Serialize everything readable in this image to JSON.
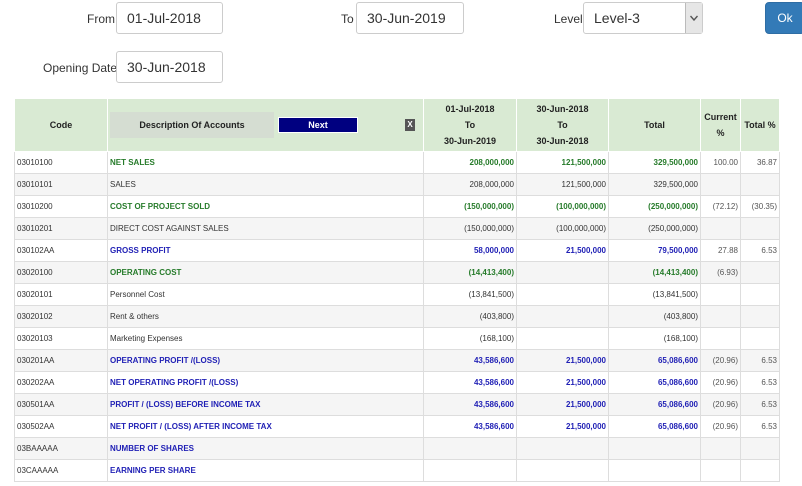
{
  "filters": {
    "from_label": "From",
    "from_value": "01-Jul-2018",
    "to_label": "To",
    "to_value": "30-Jun-2019",
    "level_label": "Level",
    "level_value": "Level-3",
    "ok_label": "Ok",
    "opening_date_label": "Opening Date",
    "opening_date_value": "30-Jun-2018"
  },
  "table": {
    "headers": {
      "code": "Code",
      "description": "Description Of Accounts",
      "next": "Next",
      "export_icon": "excel-export-icon",
      "period1_line1": "01-Jul-2018",
      "period1_line2": "To",
      "period1_line3": "30-Jun-2019",
      "period2_line1": "30-Jun-2018",
      "period2_line2": "To",
      "period2_line3": "30-Jun-2018",
      "total": "Total",
      "current_pct_line1": "Current",
      "current_pct_line2": "%",
      "total_pct": "Total %"
    },
    "rows": [
      {
        "code": "03010100",
        "desc": "NET SALES",
        "p1": "208,000,000",
        "p2": "121,500,000",
        "total": "329,500,000",
        "cur": "100.00",
        "tot": "36.87"
      },
      {
        "code": "03010101",
        "desc": "SALES",
        "p1": "208,000,000",
        "p2": "121,500,000",
        "total": "329,500,000",
        "cur": "",
        "tot": ""
      },
      {
        "code": "03010200",
        "desc": "COST OF PROJECT SOLD",
        "p1": "(150,000,000)",
        "p2": "(100,000,000)",
        "total": "(250,000,000)",
        "cur": "(72.12)",
        "tot": "(30.35)"
      },
      {
        "code": "03010201",
        "desc": "DIRECT COST AGAINST SALES",
        "p1": "(150,000,000)",
        "p2": "(100,000,000)",
        "total": "(250,000,000)",
        "cur": "",
        "tot": ""
      },
      {
        "code": "030102AA",
        "desc": "GROSS PROFIT",
        "p1": "58,000,000",
        "p2": "21,500,000",
        "total": "79,500,000",
        "cur": "27.88",
        "tot": "6.53"
      },
      {
        "code": "03020100",
        "desc": "OPERATING COST",
        "p1": "(14,413,400)",
        "p2": "",
        "total": "(14,413,400)",
        "cur": "(6.93)",
        "tot": ""
      },
      {
        "code": "03020101",
        "desc": "Personnel Cost",
        "p1": "(13,841,500)",
        "p2": "",
        "total": "(13,841,500)",
        "cur": "",
        "tot": ""
      },
      {
        "code": "03020102",
        "desc": "Rent & others",
        "p1": "(403,800)",
        "p2": "",
        "total": "(403,800)",
        "cur": "",
        "tot": ""
      },
      {
        "code": "03020103",
        "desc": "Marketing Expenses",
        "p1": "(168,100)",
        "p2": "",
        "total": "(168,100)",
        "cur": "",
        "tot": ""
      },
      {
        "code": "030201AA",
        "desc": "OPERATING PROFIT /(LOSS)",
        "p1": "43,586,600",
        "p2": "21,500,000",
        "total": "65,086,600",
        "cur": "(20.96)",
        "tot": "6.53"
      },
      {
        "code": "030202AA",
        "desc": "NET OPERATING PROFIT /(LOSS)",
        "p1": "43,586,600",
        "p2": "21,500,000",
        "total": "65,086,600",
        "cur": "(20.96)",
        "tot": "6.53"
      },
      {
        "code": "030501AA",
        "desc": "PROFIT / (LOSS) BEFORE INCOME TAX",
        "p1": "43,586,600",
        "p2": "21,500,000",
        "total": "65,086,600",
        "cur": "(20.96)",
        "tot": "6.53"
      },
      {
        "code": "030502AA",
        "desc": "NET PROFIT / (LOSS) AFTER INCOME TAX",
        "p1": "43,586,600",
        "p2": "21,500,000",
        "total": "65,086,600",
        "cur": "(20.96)",
        "tot": "6.53"
      },
      {
        "code": "03BAAAAA",
        "desc": "NUMBER OF SHARES",
        "p1": "",
        "p2": "",
        "total": "",
        "cur": "",
        "tot": ""
      },
      {
        "code": "03CAAAAA",
        "desc": "EARNING PER SHARE",
        "p1": "",
        "p2": "",
        "total": "",
        "cur": "",
        "tot": ""
      }
    ]
  },
  "colors": {
    "header_bg": "#d9ead3",
    "green_text": "#267b2a",
    "blue_text": "#1f1fb5",
    "next_button": "#000080",
    "ok_button": "#337ab7"
  }
}
